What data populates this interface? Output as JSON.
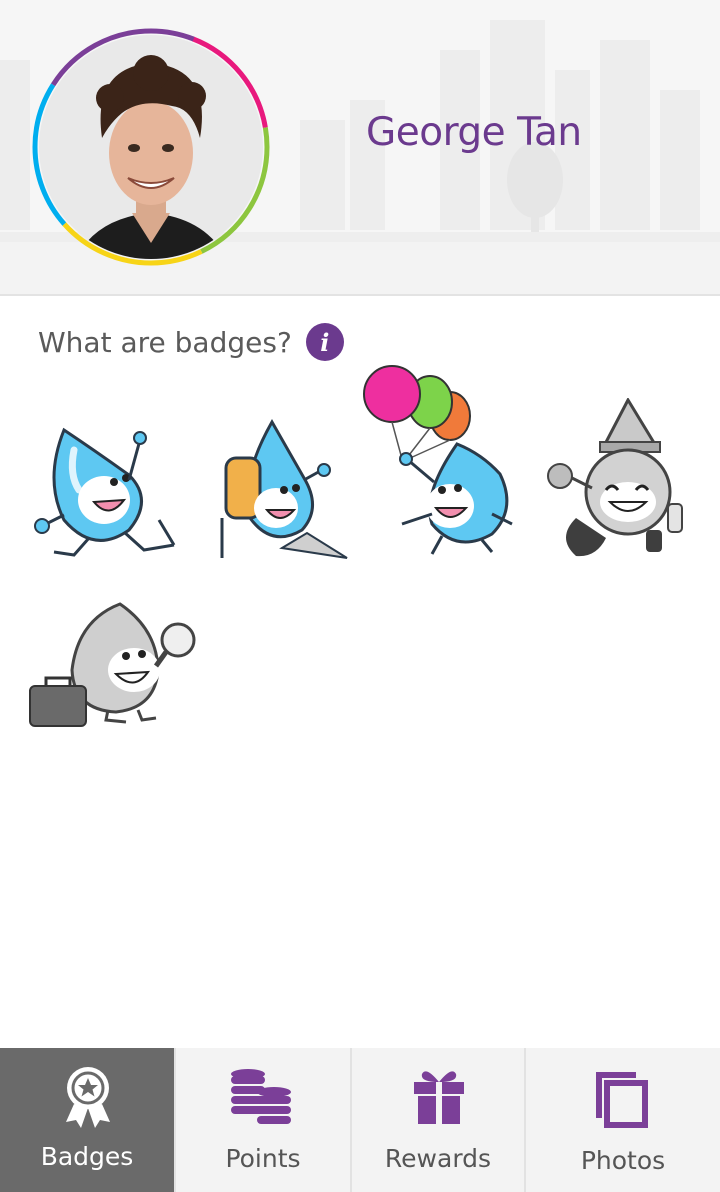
{
  "profile": {
    "name": "George Tan"
  },
  "badges_section": {
    "title": "What are badges?",
    "info_icon": "info-icon",
    "badges": [
      {
        "name": "running-droplet-badge",
        "earned": true
      },
      {
        "name": "hiker-droplet-badge",
        "earned": true
      },
      {
        "name": "balloon-droplet-badge",
        "earned": true
      },
      {
        "name": "party-droplet-badge",
        "earned": false
      },
      {
        "name": "explorer-droplet-badge",
        "earned": false
      }
    ]
  },
  "tabbar": {
    "tabs": [
      {
        "label": "Badges",
        "icon": "ribbon-badge-icon",
        "active": true
      },
      {
        "label": "Points",
        "icon": "coin-stack-icon",
        "active": false
      },
      {
        "label": "Rewards",
        "icon": "gift-icon",
        "active": false
      },
      {
        "label": "Photos",
        "icon": "photos-icon",
        "active": false
      }
    ]
  },
  "colors": {
    "accent": "#6b3a8e",
    "active_tab": "#6a6a6a",
    "droplet_blue": "#5ec8f2",
    "ring_colors": [
      "#e8197d",
      "#8dc63f",
      "#f7d417",
      "#00aeef",
      "#7b3f98"
    ]
  }
}
